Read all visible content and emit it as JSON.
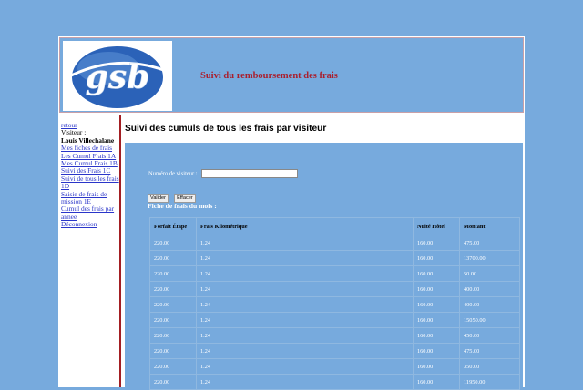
{
  "header": {
    "logo_text": "gsb",
    "title": "Suivi du remboursement des frais"
  },
  "menu": {
    "retour": "retour",
    "visiteur_label": "Visiteur :",
    "visiteur_name": "Louis Villechalane",
    "items": [
      "Mes fiches de frais",
      "Les Cumul Frais 1A",
      "Mes Cumul Frais 1B",
      "Suivi des Frais 1C",
      "Suivi de tous les frais 1D",
      "Saisie de frais de mission 1E",
      "Cumul des frais par année",
      "Déconnexion"
    ]
  },
  "content": {
    "title": "Suivi des cumuls de tous les frais par visiteur",
    "field_label": "Numéro de visiteur :",
    "field_value": "",
    "valider": "Valider",
    "effacer": "Effacer",
    "fiche_title": "Fiche de frais du mois :"
  },
  "table": {
    "headers": [
      "Forfait Étape",
      "Frais Kilométrique",
      "Nuité Hôtel",
      "Montant"
    ],
    "rows": [
      [
        "220.00",
        "1.24",
        "160.00",
        "475.00"
      ],
      [
        "220.00",
        "1.24",
        "160.00",
        "13700.00"
      ],
      [
        "220.00",
        "1.24",
        "160.00",
        "50.00"
      ],
      [
        "220.00",
        "1.24",
        "160.00",
        "400.00"
      ],
      [
        "220.00",
        "1.24",
        "160.00",
        "400.00"
      ],
      [
        "220.00",
        "1.24",
        "160.00",
        "15050.00"
      ],
      [
        "220.00",
        "1.24",
        "160.00",
        "450.00"
      ],
      [
        "220.00",
        "1.24",
        "160.00",
        "475.00"
      ],
      [
        "220.00",
        "1.24",
        "160.00",
        "350.00"
      ],
      [
        "220.00",
        "1.24",
        "160.00",
        "11950.00"
      ]
    ]
  }
}
